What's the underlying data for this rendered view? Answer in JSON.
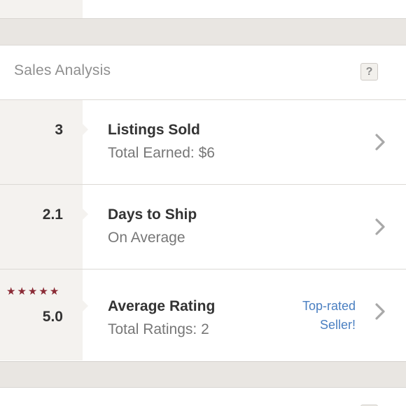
{
  "section": {
    "title": "Sales Analysis",
    "help_label": "?"
  },
  "rows": [
    {
      "value": "3",
      "title": "Listings Sold",
      "subtitle": "Total Earned: $6"
    },
    {
      "value": "2.1",
      "title": "Days to Ship",
      "subtitle": "On Average"
    },
    {
      "value": "5.0",
      "stars": 5,
      "star_glyph": "★",
      "title": "Average Rating",
      "subtitle": "Total Ratings: 2",
      "badge_line1": "Top-rated",
      "badge_line2": "Seller!"
    }
  ],
  "colors": {
    "star": "#8a2a35",
    "link": "#4a7fc1",
    "background": "#e9e6e2"
  },
  "icons": {
    "help": "question-icon",
    "chevron": "chevron-right-icon",
    "star": "star-icon"
  }
}
